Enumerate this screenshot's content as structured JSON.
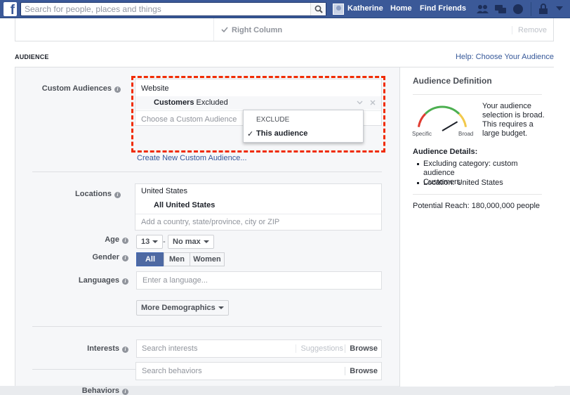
{
  "topbar": {
    "logo": "f",
    "search_placeholder": "Search for people, places and things",
    "user_name": "Katherine",
    "nav_home": "Home",
    "nav_find_friends": "Find Friends",
    "icons": [
      "friend-requests-icon",
      "messages-icon",
      "notifications-globe-icon",
      "privacy-shortcuts-icon",
      "settings-caret-icon"
    ]
  },
  "placement": {
    "item_label": "Right Column",
    "remove_label": "Remove"
  },
  "audience": {
    "section_title": "AUDIENCE",
    "help_link": "Help: Choose Your Audience",
    "custom_audiences": {
      "label": "Custom Audiences",
      "source": "Website",
      "selected_name": "Customers",
      "selected_status": "Excluded",
      "input_placeholder": "Choose a Custom Audience",
      "create_link": "Create New Custom Audience...",
      "dropdown": {
        "header": "EXCLUDE",
        "option": "This audience",
        "checkmark": "✓"
      }
    },
    "locations": {
      "label": "Locations",
      "country": "United States",
      "selected": "All United States",
      "input_placeholder": "Add a country, state/province, city or ZIP"
    },
    "age": {
      "label": "Age",
      "min": "13",
      "separator": "-",
      "max": "No max"
    },
    "gender": {
      "label": "Gender",
      "options": [
        "All",
        "Men",
        "Women"
      ],
      "selected": "All"
    },
    "languages": {
      "label": "Languages",
      "input_placeholder": "Enter a language..."
    },
    "more_demographics": "More Demographics",
    "interests": {
      "label": "Interests",
      "input_placeholder": "Search interests",
      "suggestions": "Suggestions",
      "browse": "Browse"
    },
    "behaviors": {
      "label": "Behaviors",
      "input_placeholder": "Search behaviors",
      "browse": "Browse"
    }
  },
  "definition": {
    "title": "Audience Definition",
    "gauge_left": "Specific",
    "gauge_right": "Broad",
    "gauge_level": 0.78,
    "summary_lines": [
      "Your audience",
      "selection is broad.",
      "This requires a",
      "large budget."
    ],
    "details_title": "Audience Details:",
    "details": [
      [
        "Excluding category: custom audience",
        "Customers"
      ],
      [
        "Location: United States"
      ]
    ],
    "reach": "Potential Reach: 180,000,000 people"
  },
  "colors": {
    "brand": "#3b5998",
    "highlight": "#f02b02",
    "gauge_red": "#e03c31",
    "gauge_yellow": "#f2c94c",
    "gauge_green": "#4caf50"
  }
}
